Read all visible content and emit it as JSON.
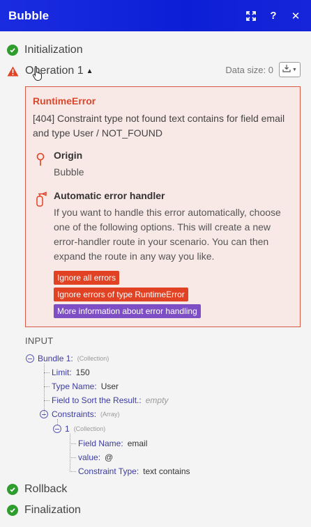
{
  "header": {
    "title": "Bubble",
    "expand_icon": "expand-icon",
    "help_label": "?",
    "close_label": "✕"
  },
  "steps": {
    "initialization": "Initialization",
    "operation": "Operation 1",
    "rollback": "Rollback",
    "finalization": "Finalization"
  },
  "data_size": "Data size: 0",
  "error": {
    "title": "RuntimeError",
    "message": "[404] Constraint type not found text contains for field email and type User / NOT_FOUND",
    "origin_title": "Origin",
    "origin_value": "Bubble",
    "handler_title": "Automatic error handler",
    "handler_text": "If you want to handle this error automatically, choose one of the following options. This will create a new error-handler route in your scenario. You can then expand the route in any way you like.",
    "btn_ignore_all": "Ignore all errors",
    "btn_ignore_type": "Ignore errors of type RuntimeError",
    "btn_more_info": "More information about error handling"
  },
  "input": {
    "label": "INPUT",
    "bundle": {
      "key": "Bundle 1:",
      "meta": "(Collection)"
    },
    "limit": {
      "key": "Limit:",
      "value": "150"
    },
    "type_name": {
      "key": "Type Name:",
      "value": "User"
    },
    "sort_field": {
      "key": "Field to Sort the Result.:",
      "value": "empty"
    },
    "constraints": {
      "key": "Constraints:",
      "meta": "(Array)"
    },
    "item": {
      "key": "1",
      "meta": "(Collection)"
    },
    "field_name": {
      "key": "Field Name:",
      "value": "email"
    },
    "value": {
      "key": "value:",
      "value": "@"
    },
    "constraint_type": {
      "key": "Constraint Type:",
      "value": "text contains"
    }
  },
  "colors": {
    "header": "#0d1fd6",
    "success": "#2e9d2e",
    "error": "#e04223",
    "info": "#7e4fc4"
  }
}
